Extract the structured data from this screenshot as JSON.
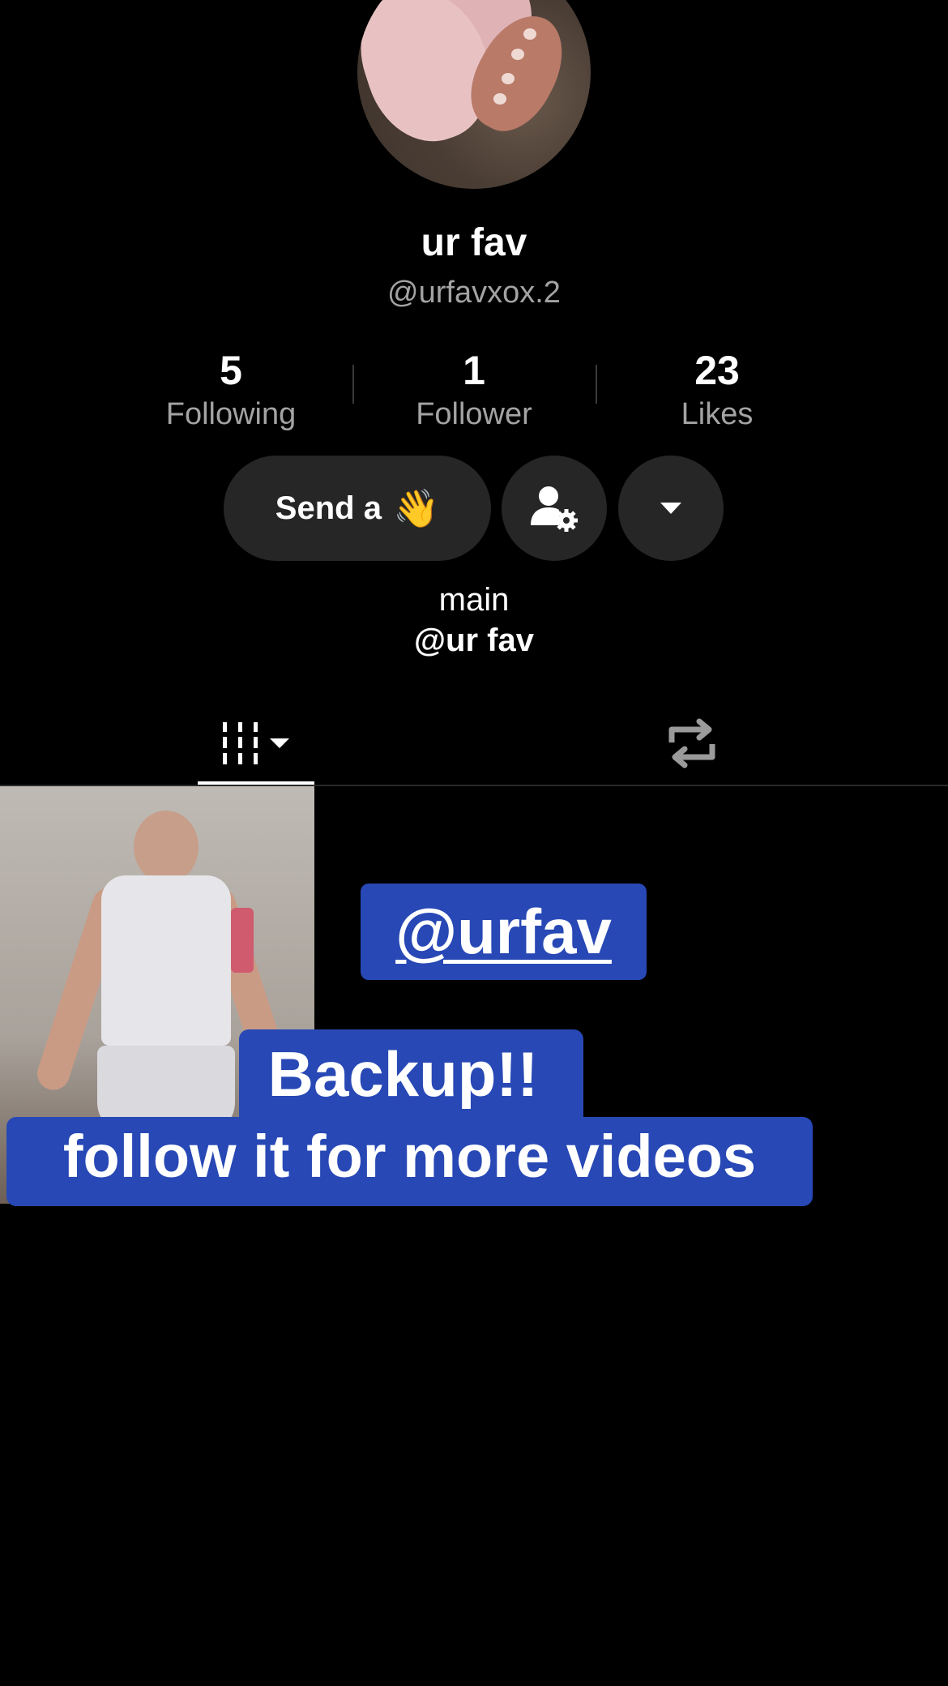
{
  "profile": {
    "display_name": "ur fav",
    "username": "@urfavxox.2",
    "avatar_icon": "avatar-image"
  },
  "stats": [
    {
      "value": "5",
      "label": "Following"
    },
    {
      "value": "1",
      "label": "Follower"
    },
    {
      "value": "23",
      "label": "Likes"
    }
  ],
  "actions": {
    "send_label": "Send a",
    "send_emoji": "👋",
    "profile_settings_icon": "person-gear-icon",
    "dropdown_icon": "caret-down-icon"
  },
  "bio": {
    "line1": "main",
    "line2": "@ur fav"
  },
  "tabs": {
    "videos_icon": "grid-lines-icon",
    "reposts_icon": "repost-icon"
  },
  "video_thumbnail": {
    "overlay_tag": "@urfav",
    "caption_line1": "Backup!!",
    "caption_line2": "follow it for more videos"
  },
  "colors": {
    "background": "#000000",
    "button_bg": "#262626",
    "caption_bg": "#2748b5",
    "secondary_text": "#a3a3a3"
  }
}
